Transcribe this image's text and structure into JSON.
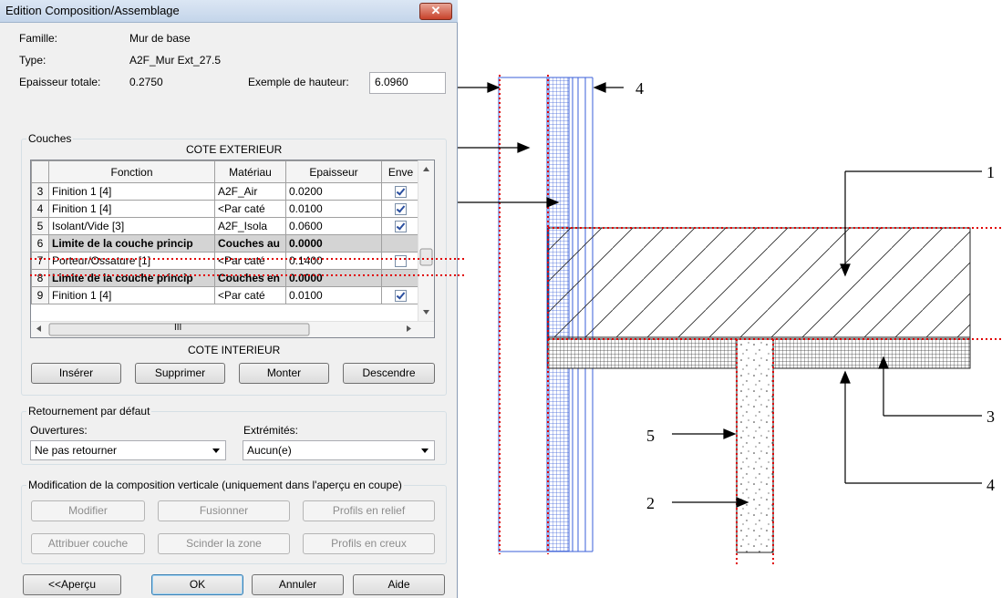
{
  "window": {
    "title": "Edition Composition/Assemblage",
    "close_glyph": "✕"
  },
  "info": {
    "famille_label": "Famille:",
    "famille_value": "Mur de base",
    "type_label": "Type:",
    "type_value": "A2F_Mur Ext_27.5",
    "epaisseur_label": "Epaisseur totale:",
    "epaisseur_value": "0.2750",
    "hauteur_label": "Exemple de hauteur:",
    "hauteur_value": "6.0960"
  },
  "couches": {
    "group_label": "Couches",
    "exterior_label": "COTE EXTERIEUR",
    "interior_label": "COTE INTERIEUR",
    "columns": [
      "",
      "Fonction",
      "Matériau",
      "Epaisseur",
      "Enve"
    ],
    "rows": [
      {
        "num": "3",
        "fonction": "Finition 1 [4]",
        "materiau": "A2F_Air",
        "epaisseur": "0.0200",
        "checked": true,
        "gray": false
      },
      {
        "num": "4",
        "fonction": "Finition 1 [4]",
        "materiau": "<Par caté",
        "epaisseur": "0.0100",
        "checked": true,
        "gray": false
      },
      {
        "num": "5",
        "fonction": "Isolant/Vide [3]",
        "materiau": "A2F_Isola",
        "epaisseur": "0.0600",
        "checked": true,
        "gray": false
      },
      {
        "num": "6",
        "fonction": "Limite de la couche princip",
        "materiau": "Couches au",
        "epaisseur": "0.0000",
        "checked": null,
        "gray": true
      },
      {
        "num": "7",
        "fonction": "Porteur/Ossature [1]",
        "materiau": "<Par caté",
        "epaisseur": "0.1400",
        "checked": false,
        "gray": false
      },
      {
        "num": "8",
        "fonction": "Limite de la couche princip",
        "materiau": "Couches en",
        "epaisseur": "0.0000",
        "checked": null,
        "gray": true
      },
      {
        "num": "9",
        "fonction": "Finition 1 [4]",
        "materiau": "<Par caté",
        "epaisseur": "0.0100",
        "checked": true,
        "gray": false
      }
    ],
    "hscroll_thumb": "III",
    "buttons": {
      "inserer": "Insérer",
      "supprimer": "Supprimer",
      "monter": "Monter",
      "descendre": "Descendre"
    }
  },
  "retournement": {
    "group_label": "Retournement par défaut",
    "ouvertures_label": "Ouvertures:",
    "ouvertures_value": "Ne pas retourner",
    "extremites_label": "Extrémités:",
    "extremites_value": "Aucun(e)"
  },
  "modification": {
    "group_label": "Modification de la composition verticale (uniquement dans l'aperçu en coupe)",
    "buttons": {
      "modifier": "Modifier",
      "fusionner": "Fusionner",
      "profils_relief": "Profils en relief",
      "attribuer": "Attribuer couche",
      "scinder": "Scinder la zone",
      "profils_creux": "Profils en creux"
    }
  },
  "footer": {
    "apercu": "<<Aperçu",
    "ok": "OK",
    "annuler": "Annuler",
    "aide": "Aide"
  },
  "drawing": {
    "callouts": [
      "4",
      "1",
      "3",
      "4",
      "5",
      "2"
    ]
  },
  "colors": {
    "red_dotted": "#e00000",
    "blue_layers": "#3a5fd8",
    "gray_rows": "#d4d4d4"
  }
}
